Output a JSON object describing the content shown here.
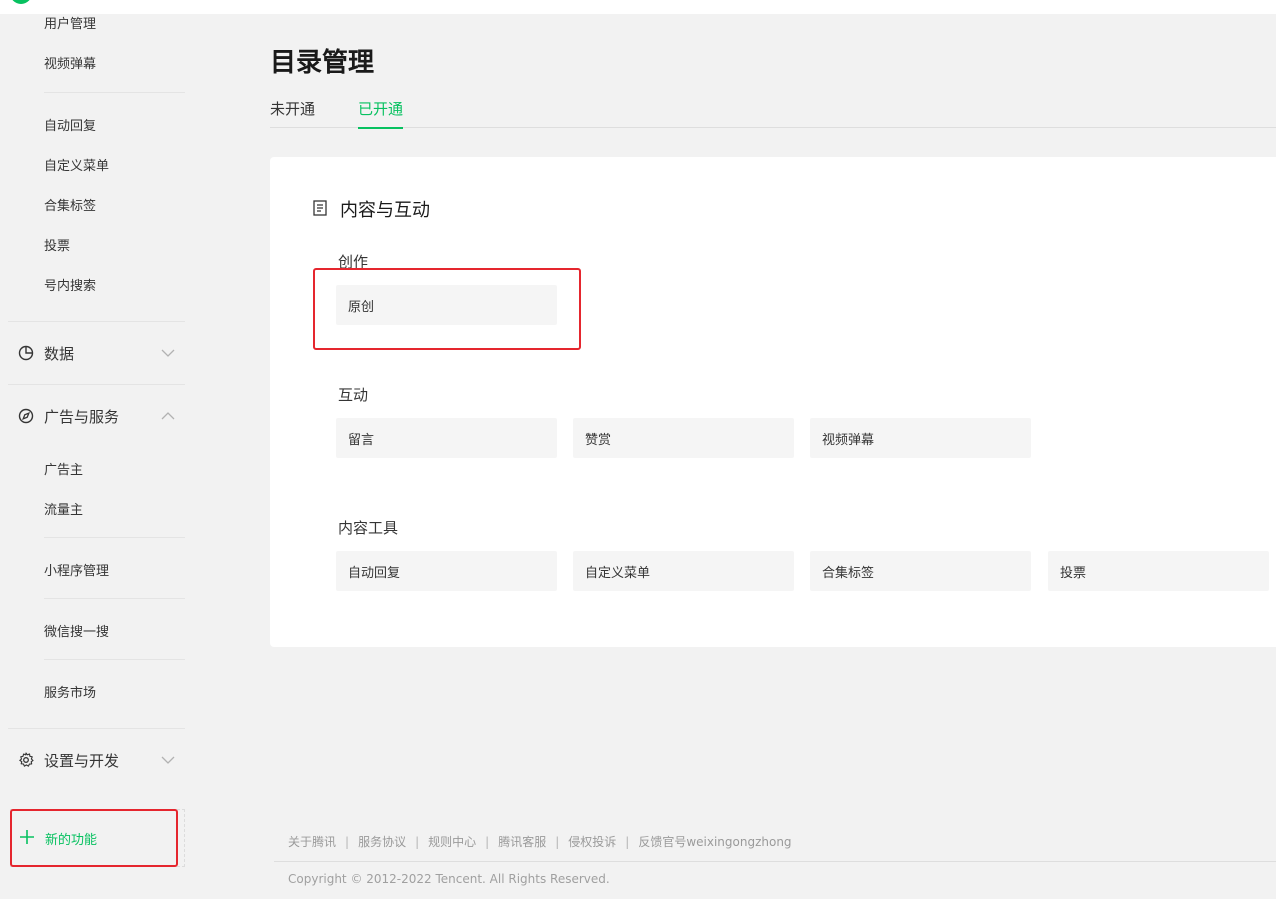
{
  "sidebar": {
    "content_items": [
      "用户管理",
      "视频弹幕"
    ],
    "tool_items": [
      "自动回复",
      "自定义菜单",
      "合集标签",
      "投票",
      "号内搜索"
    ],
    "groups": {
      "data": {
        "label": "数据",
        "icon": "pie-chart-icon",
        "state": "collapsed"
      },
      "ads": {
        "label": "广告与服务",
        "icon": "compass-icon",
        "state": "expanded"
      },
      "settings": {
        "label": "设置与开发",
        "icon": "gear-icon",
        "state": "collapsed"
      }
    },
    "ads_items": [
      "广告主",
      "流量主"
    ],
    "mini_program": "小程序管理",
    "wechat_search": "微信搜一搜",
    "service_market": "服务市场",
    "new_feature": "新的功能"
  },
  "main": {
    "title": "目录管理",
    "tabs": [
      {
        "label": "未开通",
        "active": false
      },
      {
        "label": "已开通",
        "active": true
      }
    ],
    "card": {
      "title": "内容与互动",
      "sections": [
        {
          "title": "创作",
          "tiles": [
            "原创"
          ]
        },
        {
          "title": "互动",
          "tiles": [
            "留言",
            "赞赏",
            "视频弹幕"
          ]
        },
        {
          "title": "内容工具",
          "tiles": [
            "自动回复",
            "自定义菜单",
            "合集标签",
            "投票"
          ]
        }
      ]
    }
  },
  "footer": {
    "links": [
      "关于腾讯",
      "服务协议",
      "规则中心",
      "腾讯客服",
      "侵权投诉",
      "反馈官号weixingongzhong"
    ],
    "separator": "|",
    "copyright": "Copyright © 2012-2022 Tencent. All Rights Reserved."
  },
  "colors": {
    "accent": "#07c160",
    "highlight_box": "#e5262e",
    "background": "#f2f2f2",
    "card": "#ffffff",
    "tile": "#f5f5f5"
  }
}
